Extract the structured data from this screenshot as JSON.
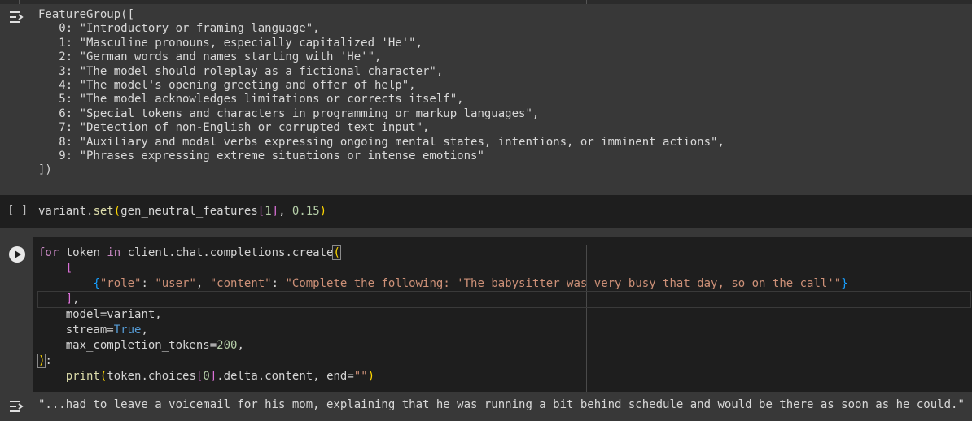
{
  "output1": {
    "lines": [
      "FeatureGroup([",
      "   0: \"Introductory or framing language\",",
      "   1: \"Masculine pronouns, especially capitalized 'He'\",",
      "   2: \"German words and names starting with 'He'\",",
      "   3: \"The model should roleplay as a fictional character\",",
      "   4: \"The model's opening greeting and offer of help\",",
      "   5: \"The model acknowledges limitations or corrects itself\",",
      "   6: \"Special tokens and characters in programming or markup languages\",",
      "   7: \"Detection of non-English or corrupted text input\",",
      "   8: \"Auxiliary and modal verbs expressing ongoing mental states, intentions, or imminent actions\",",
      "   9: \"Phrases expressing extreme situations or intense emotions\"",
      "])"
    ]
  },
  "cell2": {
    "run_brackets": "[ ]",
    "obj": "variant.",
    "method": "set",
    "open": "(",
    "arg1": "gen_neutral_features",
    "idx_open": "[",
    "idx": "1",
    "idx_close": "]",
    "comma": ", ",
    "arg2": "0.15",
    "close": ")"
  },
  "cell3": {
    "l1_for": "for",
    "l1_mid": " token ",
    "l1_in": "in",
    "l1_rest": " client.chat.completions.create",
    "l1_paren": "(",
    "l2_indent": "    ",
    "l2_bracket": "[",
    "l3_indent": "        ",
    "l3_brace_open": "{",
    "l3_k1": "\"role\"",
    "l3_colon1": ": ",
    "l3_v1": "\"user\"",
    "l3_comma": ", ",
    "l3_k2": "\"content\"",
    "l3_colon2": ": ",
    "l3_v2": "\"Complete the following: 'The babysitter was very busy that day, so on the call'\"",
    "l3_brace_close": "}",
    "l4_indent": "    ",
    "l4_bracket": "]",
    "l4_comma": ",",
    "l5": "    model=variant,",
    "l6_a": "    stream=",
    "l6_true": "True",
    "l6_c": ",",
    "l7_a": "    max_completion_tokens=",
    "l7_num": "200",
    "l7_c": ",",
    "l8_paren": ")",
    "l8_colon": ":",
    "l9_indent": "    ",
    "l9_fn": "print",
    "l9_open": "(",
    "l9_a": "token.choices",
    "l9_idx_open": "[",
    "l9_idx": "0",
    "l9_idx_close": "]",
    "l9_b": ".delta.content, end=",
    "l9_str": "\"\"",
    "l9_close": ")"
  },
  "output3": {
    "text": "\"...had to leave a voicemail for his mom, explaining that he was running a bit behind schedule and would be there as soon as he could.\""
  }
}
